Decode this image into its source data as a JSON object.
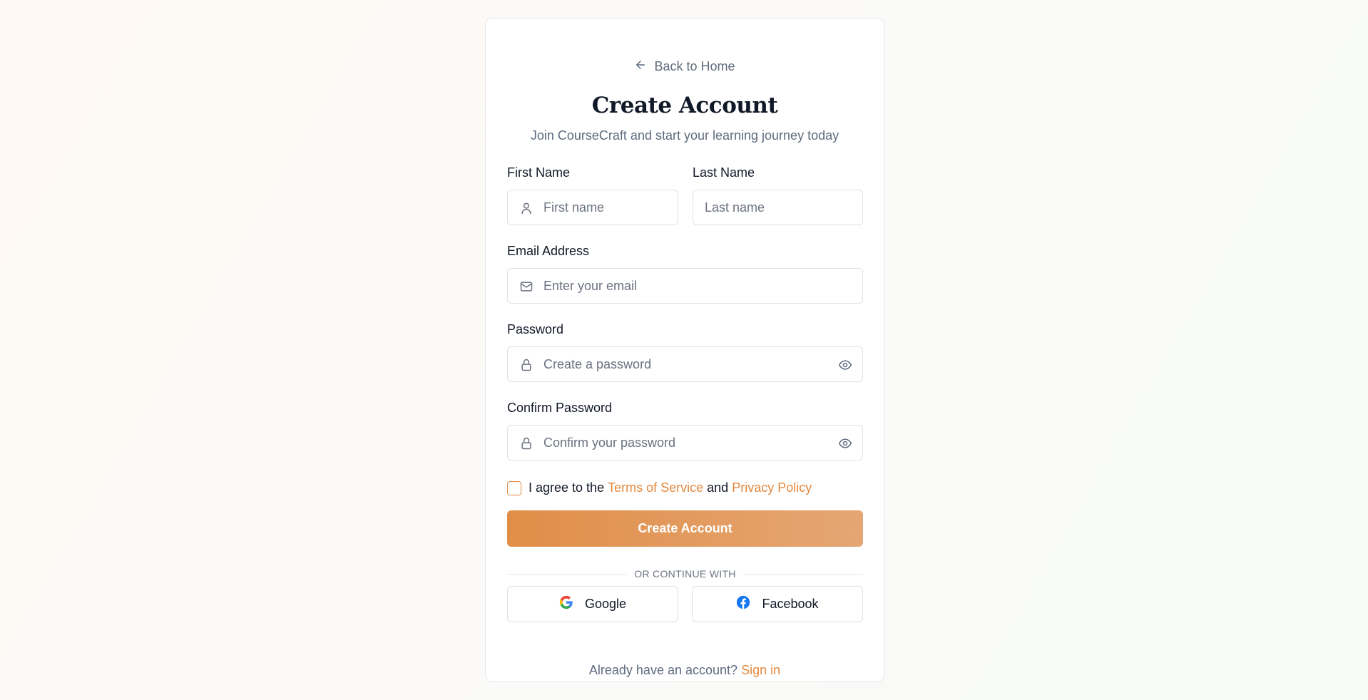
{
  "nav": {
    "back_label": "Back to Home"
  },
  "header": {
    "title": "Create Account",
    "subtitle": "Join CourseCraft and start your learning journey today"
  },
  "form": {
    "first_name": {
      "label": "First Name",
      "placeholder": "First name",
      "icon": "user-icon"
    },
    "last_name": {
      "label": "Last Name",
      "placeholder": "Last name"
    },
    "email": {
      "label": "Email Address",
      "placeholder": "Enter your email",
      "icon": "mail-icon"
    },
    "password": {
      "label": "Password",
      "placeholder": "Create a password",
      "icon": "lock-icon",
      "toggle_icon": "eye-icon"
    },
    "confirm_password": {
      "label": "Confirm Password",
      "placeholder": "Confirm your password",
      "icon": "lock-icon",
      "toggle_icon": "eye-icon"
    },
    "agree": {
      "checked": false,
      "prefix": "I agree to the",
      "terms_link": "Terms of Service",
      "middle": "and",
      "privacy_link": "Privacy Policy"
    },
    "submit_label": "Create Account"
  },
  "social": {
    "divider": "OR CONTINUE WITH",
    "google_label": "Google",
    "facebook_label": "Facebook"
  },
  "footer": {
    "prompt": "Already have an account?",
    "signin_link": "Sign in"
  },
  "colors": {
    "accent": "#e4883e",
    "button_start": "#e08e47",
    "button_end": "#e5a674",
    "muted": "#5f6b7e",
    "border": "#dde1e6"
  }
}
